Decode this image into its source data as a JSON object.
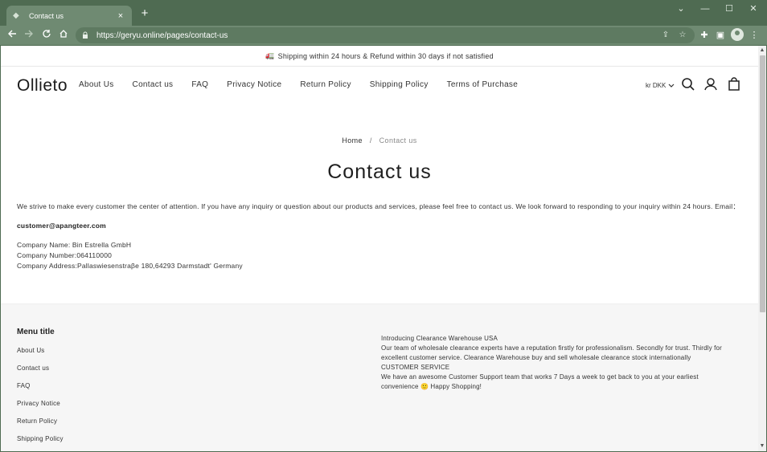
{
  "browser": {
    "tab_title": "Contact us",
    "tab_close": "×",
    "new_tab": "+",
    "url": "https://geryu.online/pages/contact-us",
    "window_controls": [
      "⌄",
      "—",
      "☐",
      "✕"
    ]
  },
  "announcement": {
    "icon": "🚛",
    "text": "Shipping within 24 hours & Refund within 30 days if not satisfied"
  },
  "header": {
    "logo": "Ollieto",
    "nav": [
      "About Us",
      "Contact us",
      "FAQ",
      "Privacy Notice",
      "Return Policy",
      "Shipping Policy",
      "Terms of Purchase"
    ],
    "currency": "kr DKK"
  },
  "breadcrumb": {
    "home": "Home",
    "separator": "/",
    "current": "Contact us"
  },
  "main": {
    "title": "Contact us",
    "intro": "We strive to make every customer the center of attention. If you have any inquiry or question about our products and services, please feel free to contact us. We look forward to responding to your inquiry within 24 hours. Email：",
    "email": "customer@apangteer.com",
    "company_name": "Company Name: Bin Estrella GmbH",
    "company_number": "Company Number:064110000",
    "company_address": "Company Address:Pallaswiesenstraβe 180,64293 Darmstadt' Germany"
  },
  "footer": {
    "menu_title": "Menu title",
    "menu_items": [
      "About Us",
      "Contact us",
      "FAQ",
      "Privacy Notice",
      "Return Policy",
      "Shipping Policy"
    ],
    "about_lines": [
      "Introducing Clearance Warehouse USA",
      "Our team of wholesale clearance experts have a reputation firstly for professionalism. Secondly for trust. Thirdly for excellent customer service. Clearance Warehouse buy and sell wholesale clearance stock internationally",
      "CUSTOMER SERVICE",
      "We have an awesome Customer Support team that works 7 Days a week to get back to you at your earliest convenience 🙂 Happy Shopping!"
    ]
  },
  "colors": {
    "chrome_dark": "#4f6b52",
    "chrome_light": "#6f8a72",
    "footer_bg": "#f6f6f6"
  }
}
